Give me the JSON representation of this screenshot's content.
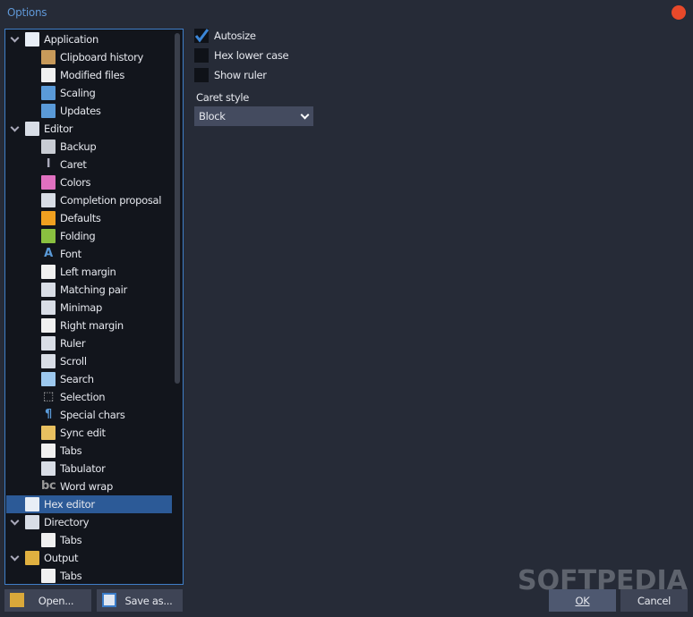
{
  "window": {
    "title": "Options"
  },
  "tree": [
    {
      "label": "Application",
      "level": 0,
      "expanded": true,
      "icon": "window-icon"
    },
    {
      "label": "Clipboard history",
      "level": 1,
      "icon": "clipboard-icon"
    },
    {
      "label": "Modified files",
      "level": 1,
      "icon": "file-edit-icon"
    },
    {
      "label": "Scaling",
      "level": 1,
      "icon": "scaling-icon"
    },
    {
      "label": "Updates",
      "level": 1,
      "icon": "update-icon"
    },
    {
      "label": "Editor",
      "level": 0,
      "expanded": true,
      "icon": "editor-icon"
    },
    {
      "label": "Backup",
      "level": 1,
      "icon": "backup-icon"
    },
    {
      "label": "Caret",
      "level": 1,
      "icon": "caret-icon"
    },
    {
      "label": "Colors",
      "level": 1,
      "icon": "color-wheel-icon"
    },
    {
      "label": "Completion proposal",
      "level": 1,
      "icon": "completion-icon"
    },
    {
      "label": "Defaults",
      "level": 1,
      "icon": "asterisk-icon"
    },
    {
      "label": "Folding",
      "level": 1,
      "icon": "folding-icon"
    },
    {
      "label": "Font",
      "level": 1,
      "icon": "font-icon"
    },
    {
      "label": "Left margin",
      "level": 1,
      "icon": "left-margin-icon"
    },
    {
      "label": "Matching pair",
      "level": 1,
      "icon": "matching-pair-icon"
    },
    {
      "label": "Minimap",
      "level": 1,
      "icon": "minimap-icon"
    },
    {
      "label": "Right margin",
      "level": 1,
      "icon": "right-margin-icon"
    },
    {
      "label": "Ruler",
      "level": 1,
      "icon": "ruler-icon"
    },
    {
      "label": "Scroll",
      "level": 1,
      "icon": "scroll-icon"
    },
    {
      "label": "Search",
      "level": 1,
      "icon": "magnifier-icon"
    },
    {
      "label": "Selection",
      "level": 1,
      "icon": "selection-icon"
    },
    {
      "label": "Special chars",
      "level": 1,
      "icon": "pilcrow-icon"
    },
    {
      "label": "Sync edit",
      "level": 1,
      "icon": "sync-edit-icon"
    },
    {
      "label": "Tabs",
      "level": 1,
      "icon": "tabs-icon"
    },
    {
      "label": "Tabulator",
      "level": 1,
      "icon": "tabulator-icon"
    },
    {
      "label": "Word wrap",
      "level": 1,
      "icon": "word-wrap-icon"
    },
    {
      "label": "Hex editor",
      "level": 0,
      "selected": true,
      "icon": "hex-file-icon"
    },
    {
      "label": "Directory",
      "level": 0,
      "expanded": true,
      "icon": "directory-icon"
    },
    {
      "label": "Tabs",
      "level": 1,
      "icon": "tabs-icon"
    },
    {
      "label": "Output",
      "level": 0,
      "expanded": true,
      "icon": "output-folder-icon"
    },
    {
      "label": "Tabs",
      "level": 1,
      "icon": "tabs-icon"
    }
  ],
  "settings": {
    "autosize": {
      "label": "Autosize",
      "checked": true
    },
    "hex_lower_case": {
      "label": "Hex lower case",
      "checked": false
    },
    "show_ruler": {
      "label": "Show ruler",
      "checked": false
    },
    "caret_style": {
      "label": "Caret style",
      "value": "Block"
    }
  },
  "buttons": {
    "open": "Open...",
    "save_as": "Save as...",
    "ok": "OK",
    "cancel": "Cancel"
  },
  "watermark": "SOFTPEDIA",
  "colors": {
    "accent": "#3f7ec7",
    "selection": "#2c5a97",
    "close": "#e8492a",
    "check": "#3b86d8"
  }
}
